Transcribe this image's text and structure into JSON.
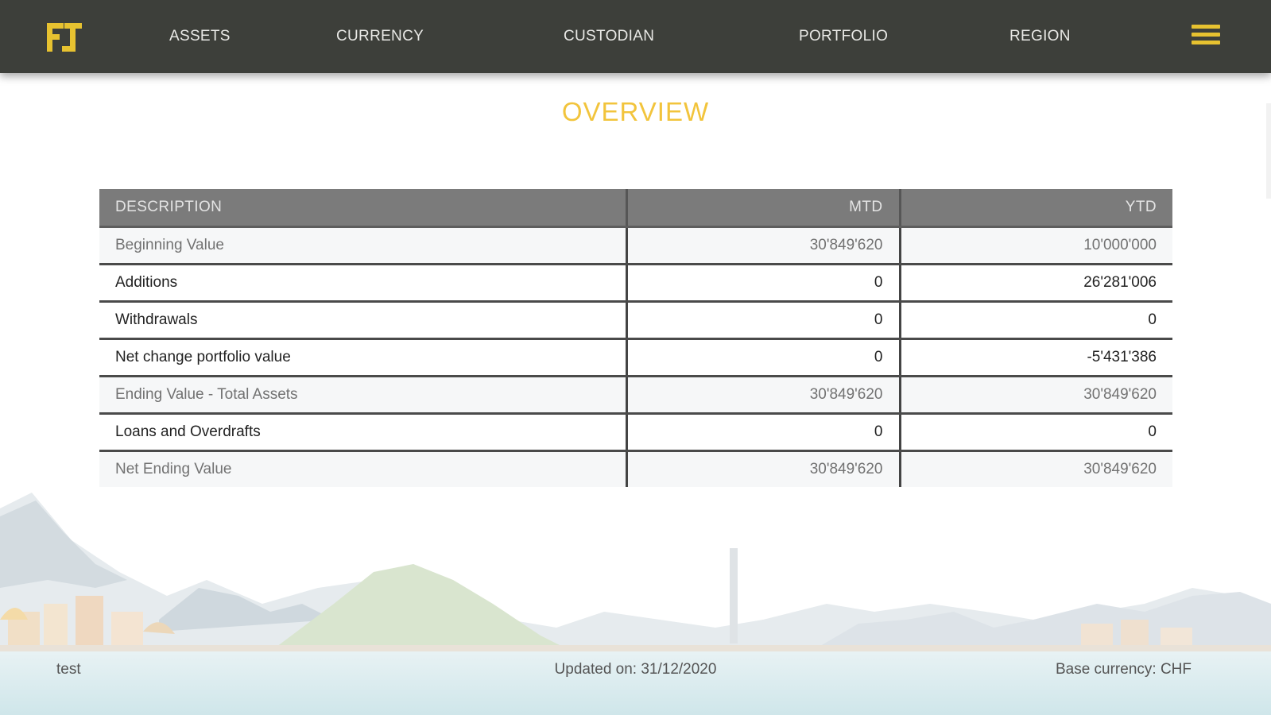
{
  "nav": {
    "logo_icon": "ft-logo-icon",
    "items": [
      {
        "label": "ASSETS"
      },
      {
        "label": "CURRENCY"
      },
      {
        "label": "CUSTODIAN"
      },
      {
        "label": "PORTFOLIO"
      },
      {
        "label": "REGION"
      }
    ],
    "menu_icon": "hamburger-menu-icon",
    "accent_color": "#e7c230",
    "bar_color": "#3d3f3a"
  },
  "page": {
    "title": "OVERVIEW",
    "title_color": "#f2c43c"
  },
  "table": {
    "headers": [
      "DESCRIPTION",
      "MTD",
      "YTD"
    ],
    "rows": [
      {
        "description": "Beginning Value",
        "mtd": "30'849'620",
        "ytd": "10'000'000",
        "subtotal": true
      },
      {
        "description": "Additions",
        "mtd": "0",
        "ytd": "26'281'006",
        "subtotal": false
      },
      {
        "description": "Withdrawals",
        "mtd": "0",
        "ytd": "0",
        "subtotal": false
      },
      {
        "description": "Net change portfolio value",
        "mtd": "0",
        "ytd": "-5'431'386",
        "subtotal": false
      },
      {
        "description": "Ending Value - Total Assets",
        "mtd": "30'849'620",
        "ytd": "30'849'620",
        "subtotal": true
      },
      {
        "description": "Loans and Overdrafts",
        "mtd": "0",
        "ytd": "0",
        "subtotal": false
      },
      {
        "description": "Net Ending Value",
        "mtd": "30'849'620",
        "ytd": "30'849'620",
        "subtotal": true
      }
    ]
  },
  "footer": {
    "left": "test",
    "center": "Updated on: 31/12/2020",
    "right": "Base currency: CHF"
  }
}
